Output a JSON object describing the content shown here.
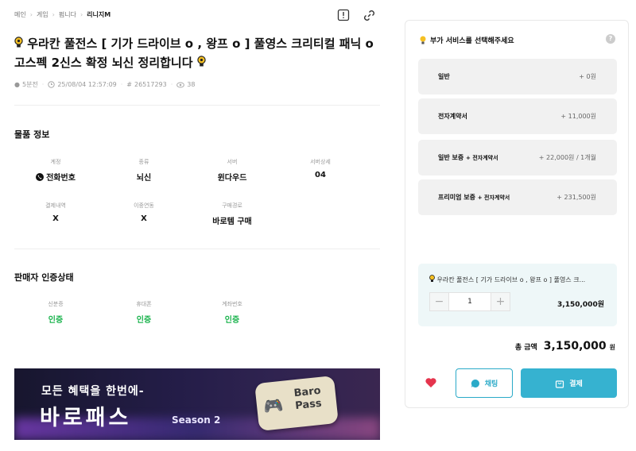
{
  "breadcrumb": {
    "items": [
      "메인",
      "게임",
      "펌니다",
      "리니지M"
    ]
  },
  "title": "우라칸 풀전스 [ 기가 드라이브 o , 왕프 o ] 풀영스 크리티컬 패닉 o 고스펙 2신스 확정 뇌신 정리합니다",
  "meta": {
    "time_ago": "5분전",
    "date": "25/08/04 12:57:09",
    "id_prefix": "#",
    "id": "26517293",
    "views": "38"
  },
  "item_info": {
    "title": "물품 정보",
    "fields": [
      {
        "label": "계정",
        "value": "전화번호"
      },
      {
        "label": "종류",
        "value": "뇌신"
      },
      {
        "label": "서버",
        "value": "윈다우드"
      },
      {
        "label": "서버상세",
        "value": "04"
      },
      {
        "label": "결제내역",
        "value": "X"
      },
      {
        "label": "이중연동",
        "value": "X"
      },
      {
        "label": "구매경로",
        "value": "바로템 구매"
      }
    ]
  },
  "seller": {
    "title": "판매자 인증상태",
    "fields": [
      {
        "label": "신분증",
        "value": "인증"
      },
      {
        "label": "휴대폰",
        "value": "인증"
      },
      {
        "label": "계좌번호",
        "value": "인증"
      }
    ]
  },
  "banner": {
    "line1": "모든 혜택을 한번에-",
    "line2": "바로패스",
    "season": "Season 2",
    "pass_line1": "Baro",
    "pass_line2": "Pass"
  },
  "panel": {
    "header": "부가 서비스를 선택해주세요",
    "help": "?",
    "options": [
      {
        "name": "일반",
        "sub": "",
        "price": "+ 0원"
      },
      {
        "name": "전자계약서",
        "sub": "",
        "price": "+ 11,000원"
      },
      {
        "name": "일반 보증",
        "sub": "+ 전자계약서",
        "price": "+ 22,000원 / 1개월"
      },
      {
        "name": "프리미엄 보증",
        "sub": "+ 전자계약서",
        "price": "+ 231,500원"
      }
    ],
    "selected": {
      "title": "우라칸 풀전스 [ 기가 드라이브 o , 왕프 o ] 풀영스 크...",
      "minus": "−",
      "qty": "1",
      "plus": "+",
      "price": "3,150,000원"
    },
    "total": {
      "label": "총 금액",
      "amount": "3,150,000",
      "unit": "원"
    },
    "chat_label": "채팅",
    "pay_label": "결제"
  },
  "colors": {
    "accent": "#36b2d0",
    "verified": "#19b34c",
    "heart": "#e5344d"
  }
}
